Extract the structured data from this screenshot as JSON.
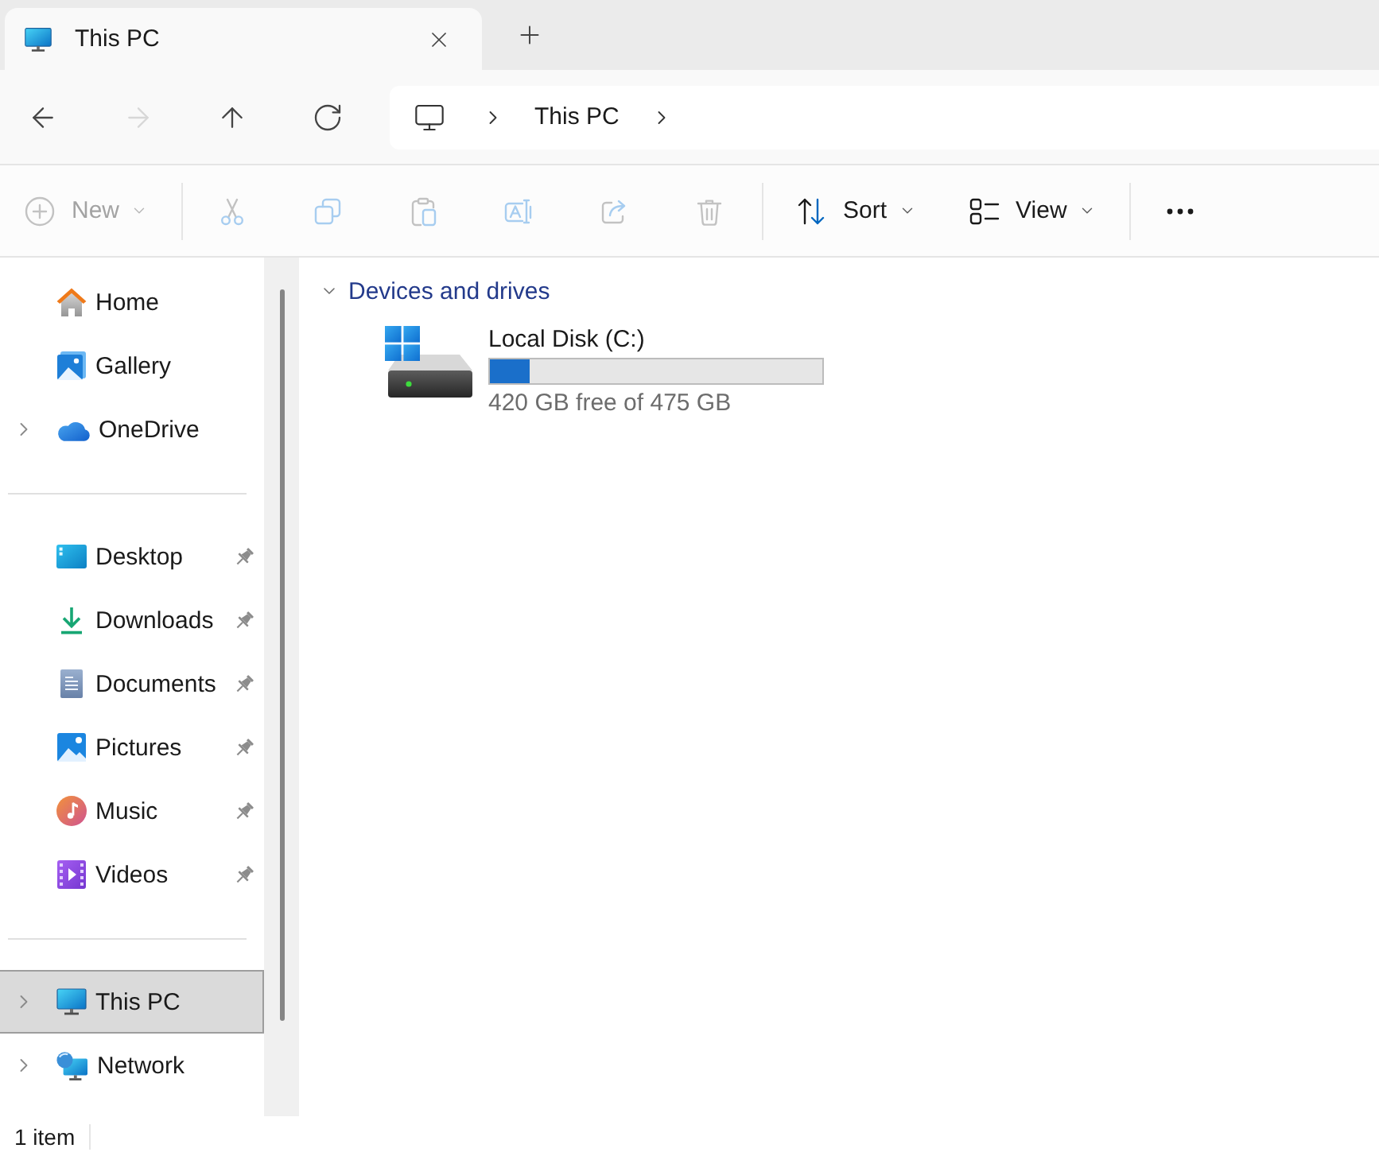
{
  "tabs": [
    {
      "title": "This PC",
      "selected": true
    }
  ],
  "nav_buttons": [
    {
      "kind": "back",
      "disabled": false
    },
    {
      "kind": "forward",
      "disabled": true
    },
    {
      "kind": "up",
      "disabled": false
    },
    {
      "kind": "refresh",
      "disabled": false
    }
  ],
  "address_bar": {
    "segments": [
      "This PC"
    ]
  },
  "command_bar": {
    "groups": [
      [
        {
          "kind": "new",
          "label": "New",
          "disabled": true
        }
      ],
      [
        {
          "kind": "cut",
          "disabled": true
        },
        {
          "kind": "copy",
          "disabled": true
        },
        {
          "kind": "paste",
          "disabled": true
        },
        {
          "kind": "rename",
          "disabled": true
        },
        {
          "kind": "share",
          "disabled": true
        },
        {
          "kind": "delete",
          "disabled": true
        }
      ],
      [
        {
          "kind": "sort",
          "label": "Sort",
          "disabled": false
        },
        {
          "kind": "view",
          "label": "View",
          "disabled": false
        }
      ],
      [
        {
          "kind": "more",
          "disabled": false
        }
      ]
    ]
  },
  "sidebar": {
    "sections": [
      {
        "items": [
          {
            "kind": "home",
            "label": "Home",
            "expandable": false,
            "pinned": false,
            "selected": false
          },
          {
            "kind": "gallery",
            "label": "Gallery",
            "expandable": false,
            "pinned": false,
            "selected": false
          },
          {
            "kind": "onedrive",
            "label": "OneDrive",
            "expandable": true,
            "pinned": false,
            "selected": false
          }
        ]
      },
      {
        "items": [
          {
            "kind": "desktop",
            "label": "Desktop",
            "expandable": false,
            "pinned": true,
            "selected": false
          },
          {
            "kind": "downloads",
            "label": "Downloads",
            "expandable": false,
            "pinned": true,
            "selected": false
          },
          {
            "kind": "documents",
            "label": "Documents",
            "expandable": false,
            "pinned": true,
            "selected": false
          },
          {
            "kind": "pictures",
            "label": "Pictures",
            "expandable": false,
            "pinned": true,
            "selected": false
          },
          {
            "kind": "music",
            "label": "Music",
            "expandable": false,
            "pinned": true,
            "selected": false
          },
          {
            "kind": "videos",
            "label": "Videos",
            "expandable": false,
            "pinned": true,
            "selected": false
          }
        ]
      },
      {
        "items": [
          {
            "kind": "thispc",
            "label": "This PC",
            "expandable": true,
            "pinned": false,
            "selected": true
          },
          {
            "kind": "network",
            "label": "Network",
            "expandable": true,
            "pinned": false,
            "selected": false
          }
        ]
      }
    ]
  },
  "content": {
    "groups": [
      {
        "title": "Devices and drives",
        "expanded": true,
        "drives": [
          {
            "name": "Local Disk (C:)",
            "level": 0.12,
            "free_space": "420 GB free of 475 GB"
          }
        ]
      }
    ]
  },
  "status_bar": {
    "item_count": "1 item"
  }
}
